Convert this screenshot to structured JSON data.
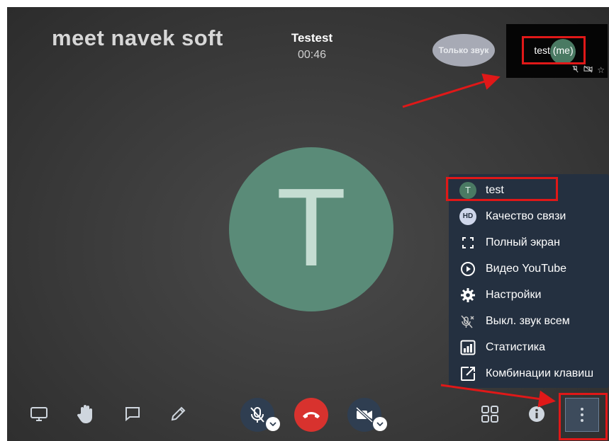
{
  "header": {
    "brand": "meet navek soft",
    "conference_title": "Testest",
    "timer": "00:46"
  },
  "audio_only_label": "Только звук",
  "self_view": {
    "name": "test (me)"
  },
  "main_avatar": {
    "initial": "T",
    "color": "#5a8b78"
  },
  "menu": {
    "items": [
      {
        "label": "test",
        "icon": "avatar-initial",
        "initial": "T"
      },
      {
        "label": "Качество связи",
        "icon": "hd-icon",
        "badge": "HD"
      },
      {
        "label": "Полный экран",
        "icon": "fullscreen-icon"
      },
      {
        "label": "Видео YouTube",
        "icon": "youtube-play-icon"
      },
      {
        "label": "Настройки",
        "icon": "gear-icon"
      },
      {
        "label": "Выкл. звук всем",
        "icon": "mute-everyone-icon"
      },
      {
        "label": "Статистика",
        "icon": "stats-icon"
      },
      {
        "label": "Комбинации клавиш",
        "icon": "shortcuts-icon"
      }
    ]
  },
  "toolbar": {
    "left": [
      "screen-share-icon",
      "raise-hand-icon",
      "chat-icon",
      "whiteboard-pen-icon"
    ],
    "center": [
      "microphone-muted-button",
      "hangup-button",
      "camera-off-button"
    ],
    "right": [
      "tile-view-icon",
      "info-icon",
      "more-options-button"
    ]
  },
  "colors": {
    "accent_red": "#e01818",
    "hangup": "#d8322e",
    "menu_bg": "#243040",
    "avatar_green": "#5a8b78"
  }
}
